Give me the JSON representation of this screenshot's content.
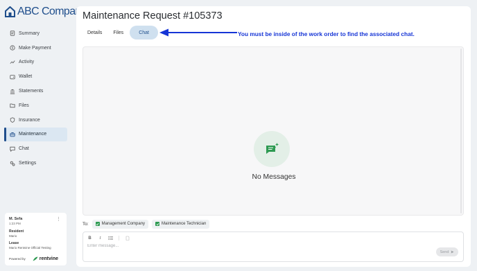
{
  "brand": {
    "name": "ABC Company"
  },
  "nav": {
    "items": [
      {
        "label": "Summary",
        "icon": "summary-icon"
      },
      {
        "label": "Make Payment",
        "icon": "dollar-icon"
      },
      {
        "label": "Activity",
        "icon": "activity-icon"
      },
      {
        "label": "Wallet",
        "icon": "wallet-icon"
      },
      {
        "label": "Statements",
        "icon": "statements-icon"
      },
      {
        "label": "Files",
        "icon": "files-icon"
      },
      {
        "label": "Insurance",
        "icon": "shield-icon"
      },
      {
        "label": "Maintenance",
        "icon": "maintenance-icon",
        "active": true
      },
      {
        "label": "Chat",
        "icon": "chat-icon"
      },
      {
        "label": "Settings",
        "icon": "settings-icon"
      }
    ]
  },
  "user_card": {
    "name": "M. Sefa",
    "time": "1:23 PM",
    "resident_label": "Resident",
    "resident_value": "Mario",
    "lease_label": "Lease",
    "lease_value": "Mario Rentvine Official Testing",
    "powered_by": "Powered by",
    "powered_brand": "rentvine"
  },
  "page": {
    "title": "Maintenance Request #105373",
    "tabs": [
      {
        "label": "Details"
      },
      {
        "label": "Files"
      },
      {
        "label": "Chat",
        "active": true
      }
    ],
    "annotation": "You must be inside of the work order to find the associated chat.",
    "annotation_color": "#1635d6"
  },
  "chat": {
    "empty_text": "No Messages",
    "to_label": "To:",
    "recipients": [
      {
        "label": "Management Company",
        "checked": true
      },
      {
        "label": "Maintenance Technician",
        "checked": true
      }
    ],
    "toolbar": {
      "bold": "B",
      "italic": "I"
    },
    "placeholder": "Enter message...",
    "send_label": "Send"
  },
  "colors": {
    "brand": "#1f4e8c",
    "accent_green": "#2e9a52",
    "active_nav_bg": "#dbe7f2"
  }
}
